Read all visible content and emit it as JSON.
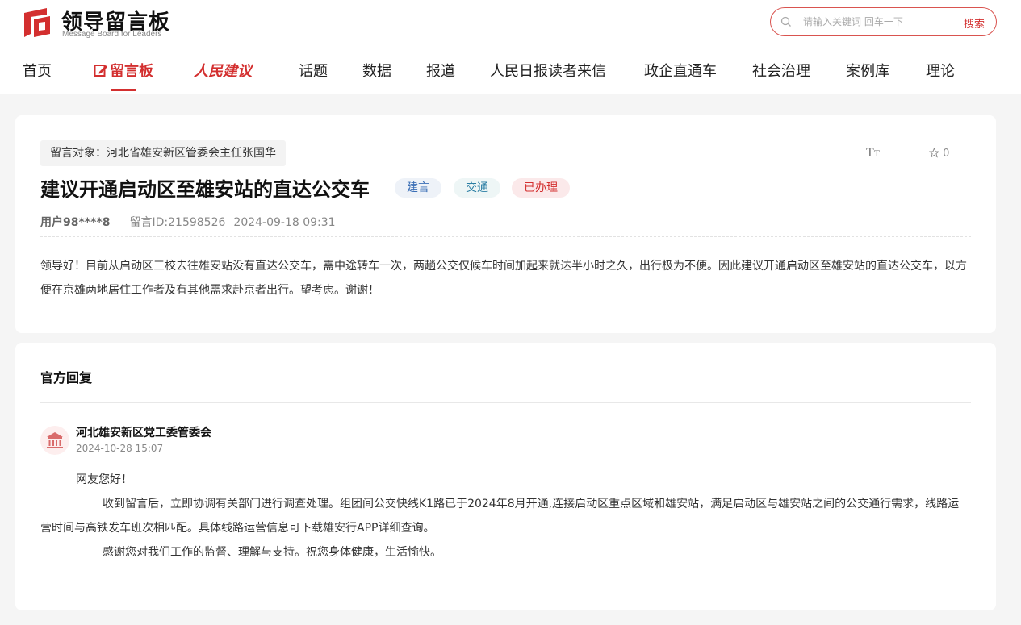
{
  "header": {
    "logo_title": "领导留言板",
    "logo_subtitle": "Message Board for Leaders",
    "search_placeholder": "请输入关键词 回车一下",
    "search_button": "搜索",
    "brand_color": "#d32f2f"
  },
  "nav": {
    "items": [
      {
        "label": "首页"
      },
      {
        "label": "留言板",
        "active": true
      },
      {
        "label": "人民建议"
      },
      {
        "label": "话题"
      },
      {
        "label": "数据"
      },
      {
        "label": "报道"
      },
      {
        "label": "人民日报读者来信"
      },
      {
        "label": "政企直通车"
      },
      {
        "label": "社会治理"
      },
      {
        "label": "案例库"
      },
      {
        "label": "理论"
      }
    ]
  },
  "message": {
    "target": "留言对象：河北省雄安新区管委会主任张国华",
    "font_toggle": "TT",
    "star_count": "0",
    "title": "建议开通启动区至雄安站的直达公交车",
    "tags": [
      {
        "label": "建言",
        "color": "#3b6fb6"
      },
      {
        "label": "交通",
        "color": "#2b7ea4"
      },
      {
        "label": "已办理",
        "color": "#d32f2f"
      }
    ],
    "user": "用户98****8",
    "message_id": "留言ID:21598526",
    "datetime": "2024-09-18 09:31",
    "body": "领导好！目前从启动区三校去往雄安站没有直达公交车，需中途转车一次，两趟公交仅候车时间加起来就达半小时之久，出行极为不便。因此建议开通启动区至雄安站的直达公交车，以方便在京雄两地居住工作者及有其他需求赴京者出行。望考虑。谢谢！"
  },
  "reply": {
    "heading": "官方回复",
    "org_name": "河北雄安新区党工委管委会",
    "org_date": "2024-10-28 15:07",
    "greeting": "网友您好！",
    "paragraph1": "收到留言后，立即协调有关部门进行调查处理。组团间公交快线K1路已于2024年8月开通,连接启动区重点区域和雄安站，满足启动区与雄安站之间的公交通行需求，线路运营时间与高铁发车班次相匹配。具体线路运营信息可下载雄安行APP详细查询。",
    "paragraph2": "感谢您对我们工作的监督、理解与支持。祝您身体健康，生活愉快。"
  }
}
